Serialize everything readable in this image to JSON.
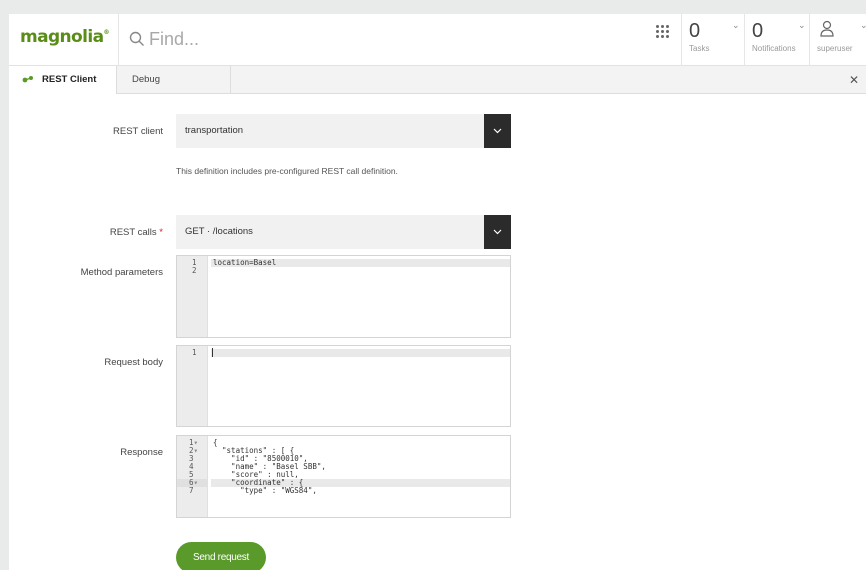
{
  "app": {
    "logo_text": "magnolia",
    "brand_color": "#5a8c18"
  },
  "topbar": {
    "search_placeholder": "Find...",
    "tasks": {
      "count": "0",
      "label": "Tasks"
    },
    "notifications": {
      "count": "0",
      "label": "Notifications"
    },
    "user": {
      "label": "superuser"
    }
  },
  "tabs": [
    {
      "label": "REST Client",
      "active": true
    },
    {
      "label": "Debug",
      "active": false
    }
  ],
  "form": {
    "rest_client": {
      "label": "REST client",
      "value": "transportation",
      "help": "This definition includes pre-configured REST call definition."
    },
    "rest_calls": {
      "label": "REST calls",
      "required_mark": "*",
      "value": "GET · /locations"
    },
    "method_parameters": {
      "label": "Method parameters",
      "line_numbers": [
        "1",
        "2"
      ],
      "lines": [
        "location=Basel",
        ""
      ]
    },
    "request_body": {
      "label": "Request body",
      "line_numbers": [
        "1"
      ],
      "lines": [
        ""
      ]
    },
    "response": {
      "label": "Response",
      "line_numbers": [
        "1",
        "2",
        "3",
        "4",
        "5",
        "6",
        "7"
      ],
      "fold_markers": [
        "▾",
        "▾",
        "",
        "",
        "",
        "▾",
        ""
      ],
      "lines": [
        "{",
        "  \"stations\" : [ {",
        "    \"id\" : \"8500010\",",
        "    \"name\" : \"Basel SBB\",",
        "    \"score\" : null,",
        "    \"coordinate\" : {",
        "      \"type\" : \"WGS84\","
      ]
    },
    "send_label": "Send request"
  },
  "colors": {
    "send_button": "#5a9a2a",
    "dropdown_button": "#2b2b2b",
    "required": "#d62323"
  }
}
